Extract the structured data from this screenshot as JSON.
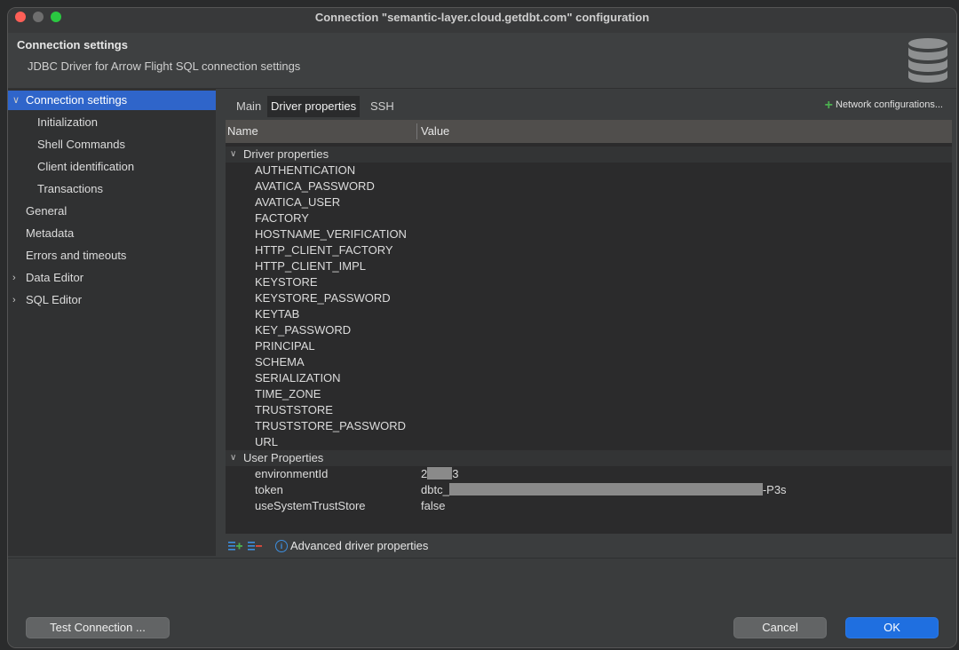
{
  "window": {
    "title": "Connection \"semantic-layer.cloud.getdbt.com\" configuration"
  },
  "header": {
    "title": "Connection settings",
    "subtitle": "JDBC Driver for Arrow Flight SQL connection settings",
    "icon": "database-icon"
  },
  "sidebar": {
    "items": [
      {
        "label": "Connection settings",
        "selected": true,
        "expander": "expanded"
      },
      {
        "label": "Initialization"
      },
      {
        "label": "Shell Commands"
      },
      {
        "label": "Client identification"
      },
      {
        "label": "Transactions"
      },
      {
        "label": "General"
      },
      {
        "label": "Metadata"
      },
      {
        "label": "Errors and timeouts"
      },
      {
        "label": "Data Editor",
        "expander": "collapsed"
      },
      {
        "label": "SQL Editor",
        "expander": "collapsed"
      }
    ]
  },
  "tabs": [
    "Main",
    "Driver properties",
    "SSH"
  ],
  "active_tab": "Driver properties",
  "network_configurations_label": "Network configurations...",
  "table": {
    "columns": [
      "Name",
      "Value"
    ],
    "groups": [
      {
        "label": "Driver properties",
        "rows": [
          {
            "name": "AUTHENTICATION",
            "value": ""
          },
          {
            "name": "AVATICA_PASSWORD",
            "value": ""
          },
          {
            "name": "AVATICA_USER",
            "value": ""
          },
          {
            "name": "FACTORY",
            "value": ""
          },
          {
            "name": "HOSTNAME_VERIFICATION",
            "value": ""
          },
          {
            "name": "HTTP_CLIENT_FACTORY",
            "value": ""
          },
          {
            "name": "HTTP_CLIENT_IMPL",
            "value": ""
          },
          {
            "name": "KEYSTORE",
            "value": ""
          },
          {
            "name": "KEYSTORE_PASSWORD",
            "value": ""
          },
          {
            "name": "KEYTAB",
            "value": ""
          },
          {
            "name": "KEY_PASSWORD",
            "value": ""
          },
          {
            "name": "PRINCIPAL",
            "value": ""
          },
          {
            "name": "SCHEMA",
            "value": ""
          },
          {
            "name": "SERIALIZATION",
            "value": ""
          },
          {
            "name": "TIME_ZONE",
            "value": ""
          },
          {
            "name": "TRUSTSTORE",
            "value": ""
          },
          {
            "name": "TRUSTSTORE_PASSWORD",
            "value": ""
          },
          {
            "name": "URL",
            "value": ""
          }
        ]
      },
      {
        "label": "User Properties",
        "rows": [
          {
            "name": "environmentId",
            "value_prefix": "2",
            "value_suffix": "3",
            "redacted": true
          },
          {
            "name": "token",
            "value_prefix": "dbtc_",
            "value_suffix": "-P3s",
            "redacted": true
          },
          {
            "name": "useSystemTrustStore",
            "value": "false"
          }
        ]
      }
    ]
  },
  "footer": {
    "add_icon": "add-row-icon",
    "remove_icon": "remove-row-icon",
    "info_icon": "info-icon",
    "advanced_label": "Advanced driver properties"
  },
  "buttons": {
    "test_connection": "Test Connection ...",
    "cancel": "Cancel",
    "ok": "OK"
  },
  "colors": {
    "accent": "#2f65ca",
    "primary_button": "#1f6fe0",
    "add_green": "#4caf50"
  }
}
